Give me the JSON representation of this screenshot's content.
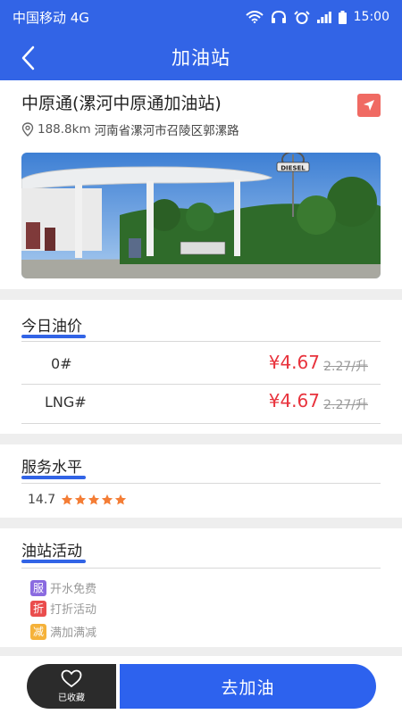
{
  "status_bar": {
    "carrier": "中国移动 4G",
    "time": "15:00"
  },
  "nav": {
    "title": "加油站"
  },
  "station": {
    "name": "中原通(漯河中原通加油站)",
    "distance": "188.8km",
    "address": "河南省漯河市召陵区郭漯路",
    "photo_sign": "DIESEL"
  },
  "prices": {
    "title": "今日油价",
    "rows": [
      {
        "grade": "0#",
        "now": "¥4.67",
        "old": "2.27/升"
      },
      {
        "grade": "LNG#",
        "now": "¥4.67",
        "old": "2.27/升"
      }
    ]
  },
  "service": {
    "title": "服务水平",
    "score": "14.7",
    "stars": 5
  },
  "activities": {
    "title": "油站活动",
    "items": [
      {
        "badge": "服",
        "text": "开水免费",
        "color": "#8a6be0"
      },
      {
        "badge": "折",
        "text": "打折活动",
        "color": "#ea4d4d"
      },
      {
        "badge": "减",
        "text": "满加满减",
        "color": "#f5b23a"
      }
    ]
  },
  "bottom": {
    "fav_label": "已收藏",
    "go_label": "去加油"
  },
  "colors": {
    "primary": "#3264e6",
    "price": "#e8323c",
    "nav_icon": "#f06a63",
    "star": "#f47d35"
  }
}
